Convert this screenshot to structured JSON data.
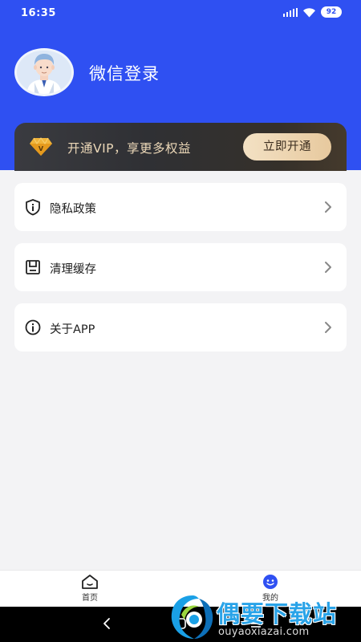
{
  "status_bar": {
    "time": "16:35",
    "battery": "92",
    "icons": [
      "signal-icon",
      "wifi-icon",
      "battery-icon"
    ]
  },
  "profile": {
    "login_text": "微信登录",
    "avatar_icon": "user-avatar-icon"
  },
  "vip": {
    "text": "开通VIP，享更多权益",
    "button_label": "立即开通",
    "icon": "diamond-icon",
    "button_color": "#e7c99e"
  },
  "menu": {
    "items": [
      {
        "label": "隐私政策",
        "icon": "shield-icon"
      },
      {
        "label": "清理缓存",
        "icon": "archive-icon"
      },
      {
        "label": "关于APP",
        "icon": "info-icon"
      }
    ]
  },
  "bottom_nav": {
    "items": [
      {
        "label": "首页",
        "icon": "home-icon",
        "active": false
      },
      {
        "label": "我的",
        "icon": "smiley-icon",
        "active": true
      }
    ]
  },
  "watermark": {
    "title": "偶要下载站",
    "url": "ouyaoxiazai.com"
  },
  "colors": {
    "header_blue": "#2f50f2",
    "background": "#f3f3f5",
    "vip_gold": "#ecd8b8",
    "active_tab": "#2f50f2"
  }
}
